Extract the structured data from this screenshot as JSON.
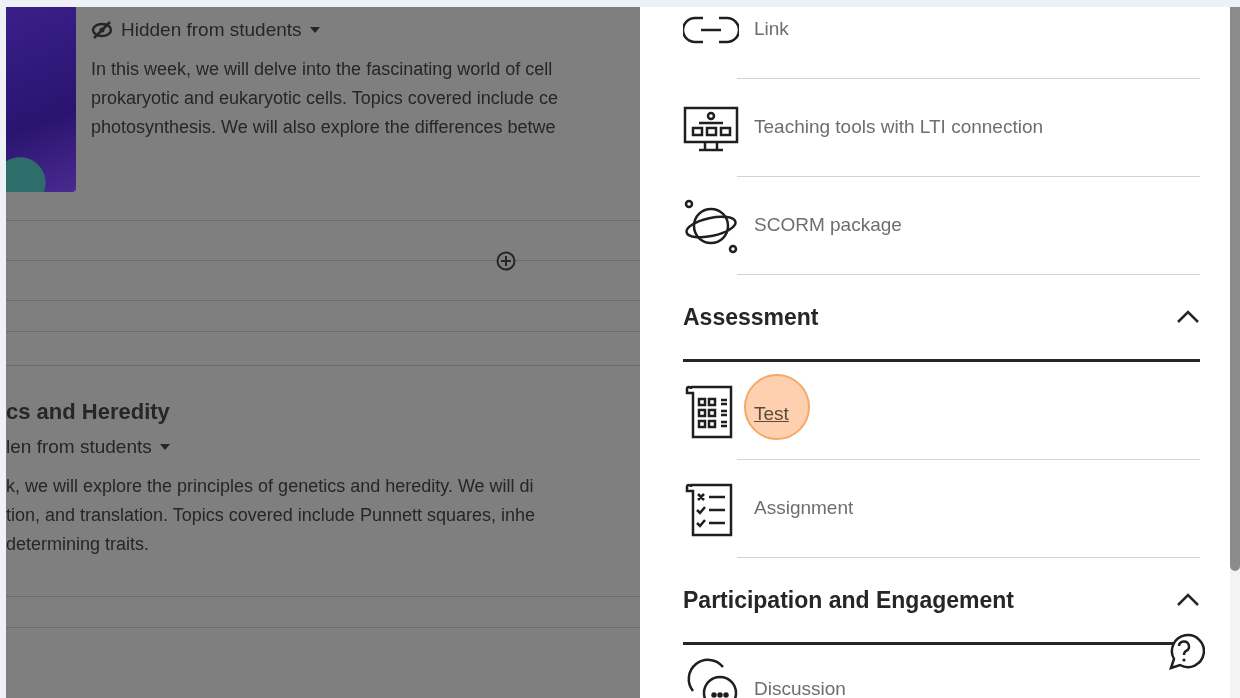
{
  "course": {
    "visibility_menu": "Hidden from students",
    "description_lines": [
      "In this week, we will delve into the fascinating world of cell",
      "prokaryotic and eukaryotic cells. Topics covered include ce",
      "photosynthesis. We will also explore the differences betwe"
    ],
    "section": {
      "title": "cs and Heredity",
      "visibility_menu": "len from students",
      "description_lines": [
        "k, we will explore the principles of genetics and heredity. We will di",
        "tion, and translation. Topics covered include Punnett squares, inhe",
        "determining traits."
      ]
    }
  },
  "panel": {
    "items": [
      {
        "label": "Link",
        "kind": "link"
      },
      {
        "label": "Teaching tools with LTI connection",
        "kind": "lti"
      },
      {
        "label": "SCORM package",
        "kind": "scorm"
      }
    ],
    "groups": [
      {
        "title": "Assessment",
        "expanded": true,
        "items": [
          {
            "label": "Test",
            "kind": "test",
            "highlighted": true
          },
          {
            "label": "Assignment",
            "kind": "assignment",
            "highlighted": false
          }
        ]
      },
      {
        "title": "Participation and Engagement",
        "expanded": true,
        "items": [
          {
            "label": "Discussion",
            "kind": "discussion",
            "highlighted": false
          }
        ]
      }
    ]
  }
}
